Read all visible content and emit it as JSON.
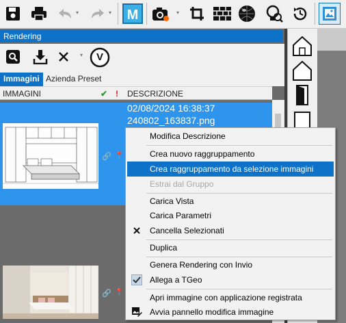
{
  "toolbar": {
    "icons": [
      "save-icon",
      "print-icon",
      "undo-icon",
      "redo-icon",
      "m-app-icon",
      "render-camera-icon",
      "crop-icon",
      "wall-bricks-icon",
      "sphere-icon",
      "idea-lamp-icon",
      "history-icon",
      "image-gallery-icon"
    ]
  },
  "panel": {
    "title": "Rendering",
    "tools": [
      "zoom-search-icon",
      "download-icon",
      "close-icon",
      "v-circle-icon"
    ],
    "v_label": "V",
    "tabs": [
      {
        "label": "Immagini",
        "active": true
      },
      {
        "label": "Azienda Preset",
        "active": false
      }
    ],
    "columns": {
      "images": "IMMAGINI",
      "check": "✔",
      "flag": "!",
      "description": "DESCRIZIONE"
    }
  },
  "rows": [
    {
      "date": "02/08/2024 16:38:37",
      "filename": "240802_163837.png",
      "selected": true
    },
    {
      "date": "",
      "filename": "",
      "selected": false
    }
  ],
  "context_menu": {
    "items": [
      {
        "label": "Modifica Descrizione",
        "icon": null
      },
      {
        "label": "Crea nuovo raggruppamento",
        "icon": null
      },
      {
        "label": "Crea raggruppamento da selezione immagini",
        "icon": null,
        "highlighted": true
      },
      {
        "label": "Estrai dal Gruppo",
        "icon": null,
        "disabled": true
      },
      {
        "label": "Carica Vista",
        "icon": null
      },
      {
        "label": "Carica Parametri",
        "icon": null
      },
      {
        "label": "Cancella Selezionati",
        "icon": "close-icon"
      },
      {
        "label": "Duplica",
        "icon": null
      },
      {
        "label": "Genera Rendering con Invio",
        "icon": null
      },
      {
        "label": "Allega a TGeo",
        "icon": "checkbox-checked-icon"
      },
      {
        "label": "Apri immagine con applicazione registrata",
        "icon": null
      },
      {
        "label": "Avvia pannello modifica immagine",
        "icon": "image-edit-icon"
      }
    ]
  },
  "colors": {
    "accent": "#0e73c8",
    "selection": "#2f95ec",
    "menu_bg": "#f2f2f2",
    "panel_bg": "#6b6b6b"
  }
}
